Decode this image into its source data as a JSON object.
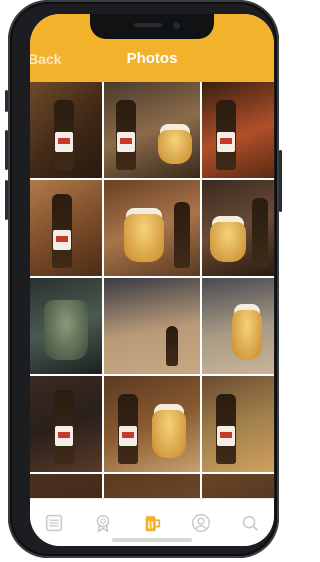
{
  "header": {
    "back_label": "Back",
    "title": "Photos"
  },
  "colors": {
    "accent": "#f2b22c",
    "tab_inactive": "#c8c8c8",
    "tab_active": "#f2b22c"
  },
  "photos": [
    {
      "icon": "beer-bottle-photo"
    },
    {
      "icon": "beer-bottle-photo"
    },
    {
      "icon": "beer-glass-photo"
    },
    {
      "icon": "beer-bottle-photo"
    },
    {
      "icon": "beer-glass-photo"
    },
    {
      "icon": "beer-glass-photo"
    },
    {
      "icon": "glass-photo"
    },
    {
      "icon": "table-photo"
    },
    {
      "icon": "beer-glass-photo"
    },
    {
      "icon": "beer-bottle-photo"
    },
    {
      "icon": "beer-glass-photo"
    },
    {
      "icon": "beer-bottle-photo"
    }
  ],
  "tabs": [
    {
      "icon": "list-icon",
      "active": false
    },
    {
      "icon": "badge-icon",
      "active": false
    },
    {
      "icon": "beer-mug-icon",
      "active": true
    },
    {
      "icon": "profile-icon",
      "active": false
    },
    {
      "icon": "search-icon",
      "active": false
    }
  ]
}
